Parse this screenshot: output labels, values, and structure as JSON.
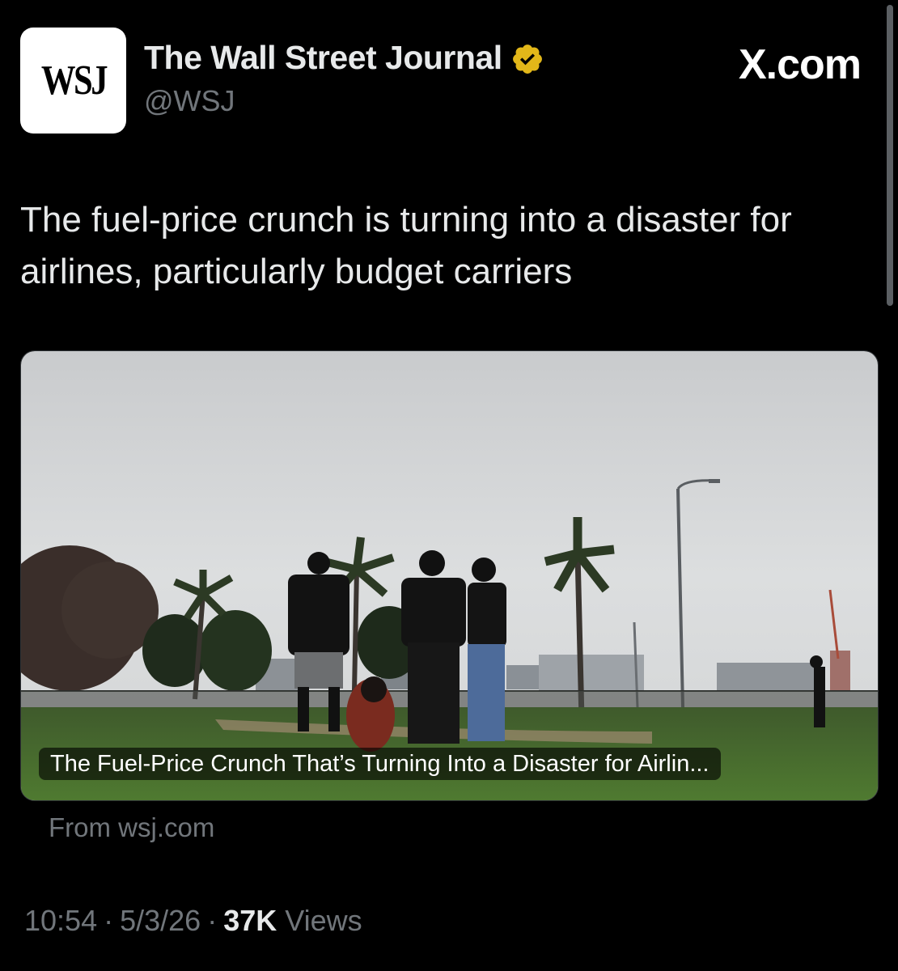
{
  "header": {
    "avatar_text": "WSJ",
    "account_name": "The Wall Street Journal",
    "handle": "@WSJ",
    "brand": "X.com"
  },
  "tweet": {
    "text": "The fuel-price crunch is turning into a disaster for airlines, particularly budget carriers"
  },
  "card": {
    "title": "The Fuel-Price Crunch That’s Turning Into a Disaster for Airlin...",
    "source": "From wsj.com"
  },
  "meta": {
    "time": "10:54",
    "date": "5/3/26",
    "views_count": "37K",
    "views_label": "Views",
    "separator": "·"
  },
  "colors": {
    "background": "#000000",
    "verified_badge": "#e2b719",
    "secondary_text": "#71767b",
    "primary_text": "#e7e9ea"
  },
  "icons": {
    "verified": "verified-badge-icon",
    "card_image": "photo-people-park-cloudy-sky"
  }
}
